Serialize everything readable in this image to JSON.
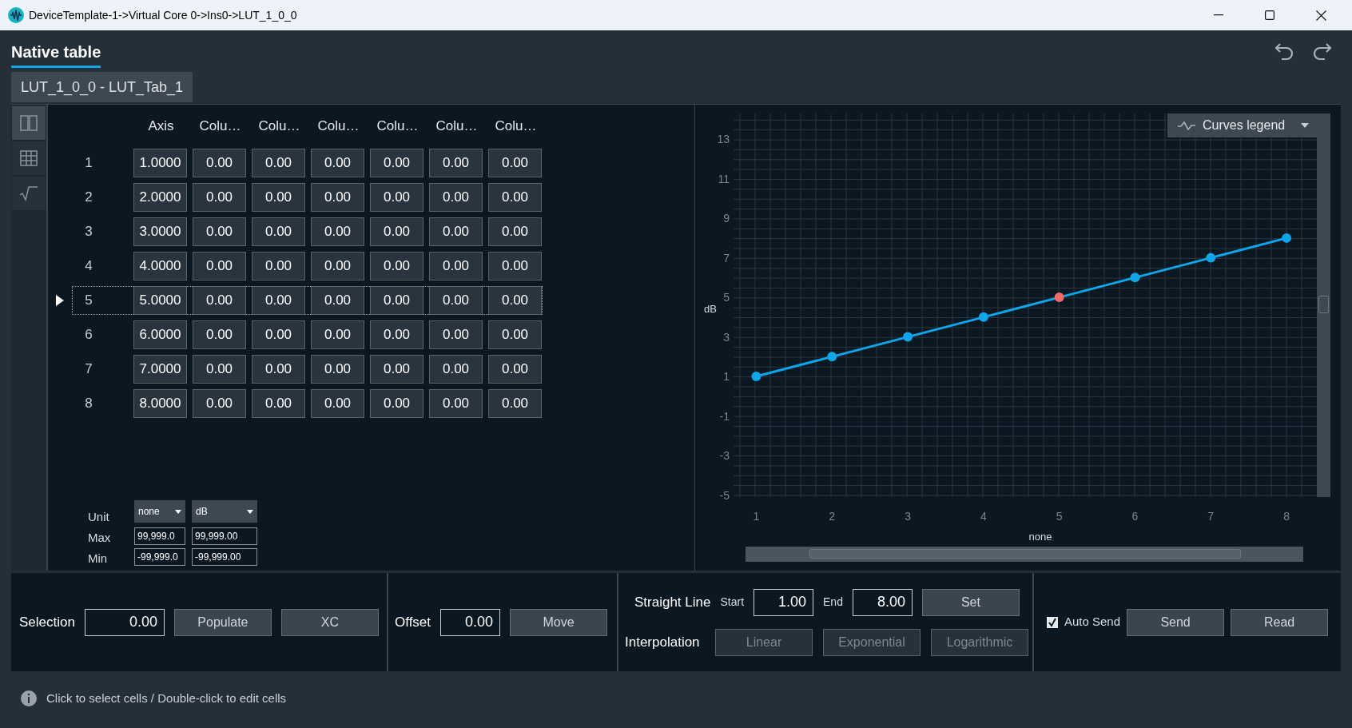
{
  "window": {
    "title": "DeviceTemplate-1->Virtual Core 0->Ins0->LUT_1_0_0"
  },
  "header": {
    "title": "Native table"
  },
  "tabs": [
    {
      "label": "LUT_1_0_0 - LUT_Tab_1",
      "selected": true
    }
  ],
  "view_modes": [
    {
      "kind": "split",
      "selected": true
    },
    {
      "kind": "table",
      "selected": false
    },
    {
      "kind": "formula",
      "selected": false
    }
  ],
  "table": {
    "columns": [
      "Axis",
      "Colu…",
      "Colu…",
      "Colu…",
      "Colu…",
      "Colu…",
      "Colu…"
    ],
    "rows": [
      {
        "label": "1",
        "selected": false,
        "cells": [
          "1.0000",
          "0.00",
          "0.00",
          "0.00",
          "0.00",
          "0.00",
          "0.00"
        ]
      },
      {
        "label": "2",
        "selected": false,
        "cells": [
          "2.0000",
          "0.00",
          "0.00",
          "0.00",
          "0.00",
          "0.00",
          "0.00"
        ]
      },
      {
        "label": "3",
        "selected": false,
        "cells": [
          "3.0000",
          "0.00",
          "0.00",
          "0.00",
          "0.00",
          "0.00",
          "0.00"
        ]
      },
      {
        "label": "4",
        "selected": false,
        "cells": [
          "4.0000",
          "0.00",
          "0.00",
          "0.00",
          "0.00",
          "0.00",
          "0.00"
        ]
      },
      {
        "label": "5",
        "selected": true,
        "cells": [
          "5.0000",
          "0.00",
          "0.00",
          "0.00",
          "0.00",
          "0.00",
          "0.00"
        ]
      },
      {
        "label": "6",
        "selected": false,
        "cells": [
          "6.0000",
          "0.00",
          "0.00",
          "0.00",
          "0.00",
          "0.00",
          "0.00"
        ]
      },
      {
        "label": "7",
        "selected": false,
        "cells": [
          "7.0000",
          "0.00",
          "0.00",
          "0.00",
          "0.00",
          "0.00",
          "0.00"
        ]
      },
      {
        "label": "8",
        "selected": false,
        "cells": [
          "8.0000",
          "0.00",
          "0.00",
          "0.00",
          "0.00",
          "0.00",
          "0.00"
        ]
      }
    ]
  },
  "axis_settings": {
    "unit_label": "Unit",
    "max_label": "Max",
    "min_label": "Min",
    "columns": [
      {
        "unit": "none",
        "max": "99,999.0",
        "min": "-99,999.0"
      },
      {
        "unit": "dB",
        "max": "99,999.00",
        "min": "-99,999.00"
      }
    ]
  },
  "chart": {
    "legend_label": "Curves legend",
    "chart_data": {
      "type": "line",
      "xlabel": "none",
      "ylabel": "dB",
      "x": [
        1,
        2,
        3,
        4,
        5,
        6,
        7,
        8
      ],
      "series": [
        {
          "color": "#0ea5e9",
          "marker": "circle",
          "values": [
            1,
            2,
            3,
            4,
            5,
            6,
            7,
            8
          ]
        }
      ],
      "xticks": [
        1,
        2,
        3,
        4,
        5,
        6,
        7,
        8
      ],
      "yticks": [
        -5,
        -3,
        -1,
        1,
        3,
        5,
        7,
        9,
        11,
        13
      ],
      "xlim": [
        0.7,
        8.4
      ],
      "ylim": [
        -5.1,
        14.3
      ],
      "grid": true
    }
  },
  "toolbar": {
    "selection": {
      "label": "Selection",
      "value": "0.00",
      "buttons": [
        "Populate",
        "XC"
      ]
    },
    "offset": {
      "label": "Offset",
      "value": "0.00",
      "button": "Move"
    },
    "straight_line": {
      "label": "Straight Line",
      "start_label": "Start",
      "start": "1.00",
      "end_label": "End",
      "end": "8.00",
      "button": "Set"
    },
    "interpolation": {
      "label": "Interpolation",
      "buttons": [
        {
          "label": "Linear",
          "disabled": true
        },
        {
          "label": "Exponential",
          "disabled": true
        },
        {
          "label": "Logarithmic",
          "disabled": true
        }
      ]
    },
    "auto_send": {
      "label": "Auto Send",
      "checked": true
    },
    "buttons": [
      "Send",
      "Read"
    ]
  },
  "status_bar": {
    "text": "Click to select cells / Double-click to edit cells"
  }
}
